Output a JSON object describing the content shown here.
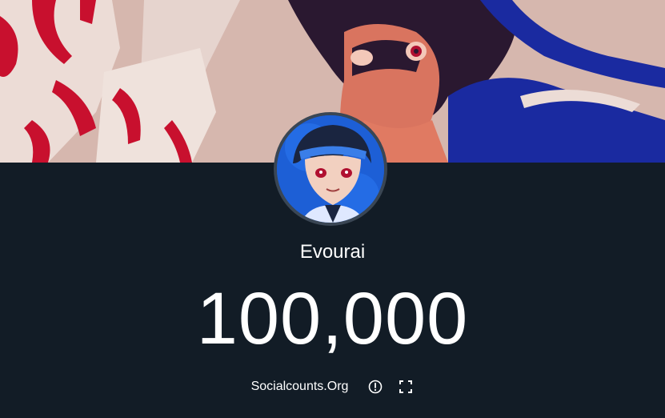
{
  "channel": {
    "name": "Evourai",
    "subscriber_count": "100,000"
  },
  "banner": {
    "icon": "anime-artwork-banner"
  },
  "avatar": {
    "icon": "anime-character-avatar"
  },
  "footer": {
    "link_label": "Socialcounts.Org",
    "info_icon": "info-circle-icon",
    "fullscreen_icon": "fullscreen-icon"
  },
  "colors": {
    "background": "#121c26",
    "text": "#ffffff",
    "avatar_ring": "#3a4654"
  }
}
